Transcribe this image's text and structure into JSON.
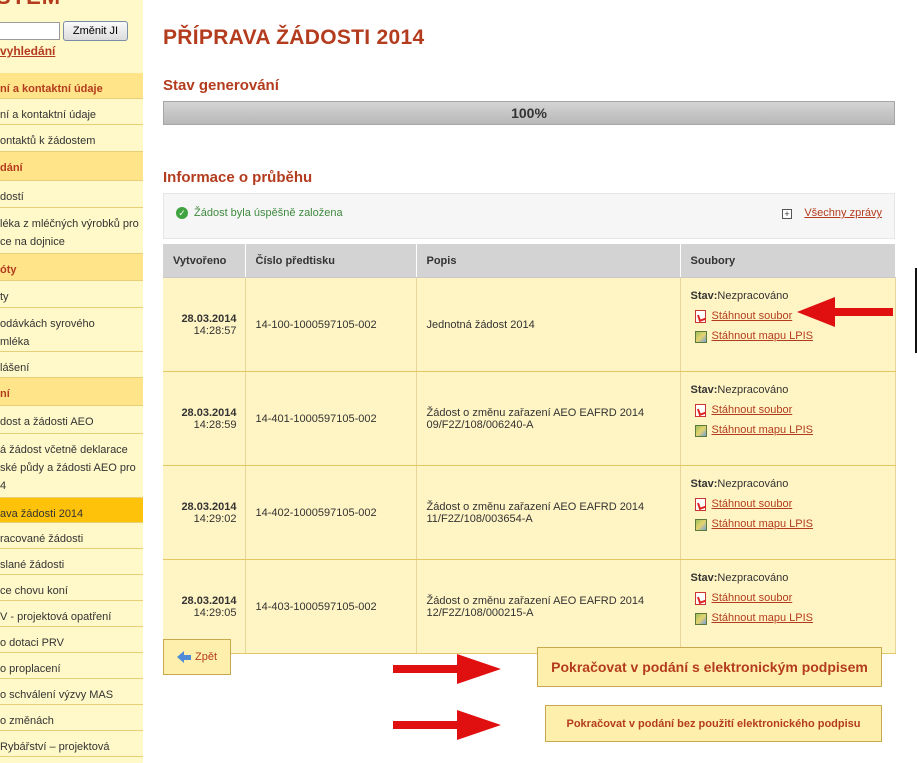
{
  "sidebar": {
    "logo": "STÉM",
    "change_button": "Změnit JI",
    "advanced_search": "vyhledání",
    "items": [
      {
        "label": "ní a kontaktní údaje",
        "type": "hd",
        "h": 26
      },
      {
        "label": "ní a kontaktní údaje",
        "type": "item",
        "h": 26
      },
      {
        "label": "ontaktů k žádostem",
        "type": "item",
        "h": 27
      },
      {
        "label": "dání",
        "type": "hd",
        "h": 29
      },
      {
        "label": "dostí",
        "type": "item",
        "h": 27
      },
      {
        "label": "léka z mléčných výrobků pro",
        "label2": "ce na dojnice",
        "type": "item",
        "h": 46
      },
      {
        "label": "óty",
        "type": "hd",
        "h": 27
      },
      {
        "label": "ty",
        "type": "item",
        "h": 27
      },
      {
        "label": "odávkách syrového",
        "label2": "mléka",
        "type": "item",
        "h": 44
      },
      {
        "label": "lášení",
        "type": "item",
        "h": 26
      },
      {
        "label": "ní",
        "type": "hd",
        "h": 28
      },
      {
        "label": "dost a žádosti AEO",
        "type": "item",
        "h": 28
      },
      {
        "label": "á žádost včetně deklarace",
        "label2": "ské půdy a žádosti AEO pro",
        "label3": "4",
        "type": "item",
        "h": 64
      },
      {
        "label": "ava žádosti 2014",
        "type": "active",
        "h": 25
      },
      {
        "label": "racované žádosti",
        "type": "item",
        "h": 26
      },
      {
        "label": "slané žádosti",
        "type": "item",
        "h": 26
      },
      {
        "label": "ce chovu koní",
        "type": "item",
        "h": 26
      },
      {
        "label": "V - projektová opatření",
        "type": "item",
        "h": 26
      },
      {
        "label": "o dotaci PRV",
        "type": "item",
        "h": 26
      },
      {
        "label": "o proplacení",
        "type": "item",
        "h": 26
      },
      {
        "label": "o schválení výzvy MAS",
        "type": "item",
        "h": 26
      },
      {
        "label": "o změnách",
        "type": "item",
        "h": 26
      },
      {
        "label": " Rybářství – projektová",
        "type": "item",
        "h": 26
      }
    ]
  },
  "page_title": "PŘÍPRAVA ŽÁDOSTI 2014",
  "generation": {
    "heading": "Stav generování",
    "progress_text": "100%",
    "progress_value": 100
  },
  "info": {
    "heading": "Informace o průběhu",
    "success_message": "Žádost byla úspěšně založena",
    "all_messages_link": "Všechny zprávy"
  },
  "table": {
    "headers": [
      "Vytvořeno",
      "Číslo předtisku",
      "Popis",
      "Soubory"
    ],
    "rows": [
      {
        "date": "28.03.2014",
        "time": "14:28:57",
        "number": "14-100-1000597105-002",
        "desc1": "Jednotná žádost 2014",
        "desc2": "",
        "status_label": "Stav:",
        "status": "Nezpracováno",
        "download": "Stáhnout soubor",
        "download_map": "Stáhnout mapu LPIS"
      },
      {
        "date": "28.03.2014",
        "time": "14:28:59",
        "number": "14-401-1000597105-002",
        "desc1": "Žádost o změnu zařazení AEO EAFRD 2014",
        "desc2": "09/F2Z/108/006240-A",
        "status_label": "Stav:",
        "status": "Nezpracováno",
        "download": "Stáhnout soubor",
        "download_map": "Stáhnout mapu LPIS"
      },
      {
        "date": "28.03.2014",
        "time": "14:29:02",
        "number": "14-402-1000597105-002",
        "desc1": "Žádost o změnu zařazení AEO EAFRD 2014",
        "desc2": "11/F2Z/108/003654-A",
        "status_label": "Stav:",
        "status": "Nezpracováno",
        "download": "Stáhnout soubor",
        "download_map": "Stáhnout mapu LPIS"
      },
      {
        "date": "28.03.2014",
        "time": "14:29:05",
        "number": "14-403-1000597105-002",
        "desc1": "Žádost o změnu zařazení AEO EAFRD 2014",
        "desc2": "12/F2Z/108/000215-A",
        "status_label": "Stav:",
        "status": "Nezpracováno",
        "download": "Stáhnout soubor",
        "download_map": "Stáhnout mapu LPIS"
      }
    ]
  },
  "buttons": {
    "back": "Zpět",
    "continue_signed": "Pokračovat v podání s elektronickým podpisem",
    "continue_unsigned": "Pokračovat v podání bez použití elektronického podpisu"
  },
  "colors": {
    "accent": "#b43c1e",
    "sidebar_bg": "#fff8c8",
    "sidebar_header": "#ffe48a",
    "sidebar_active": "#ffc20a",
    "row_bg": "#fff4c3",
    "arrow": "#e01010"
  }
}
